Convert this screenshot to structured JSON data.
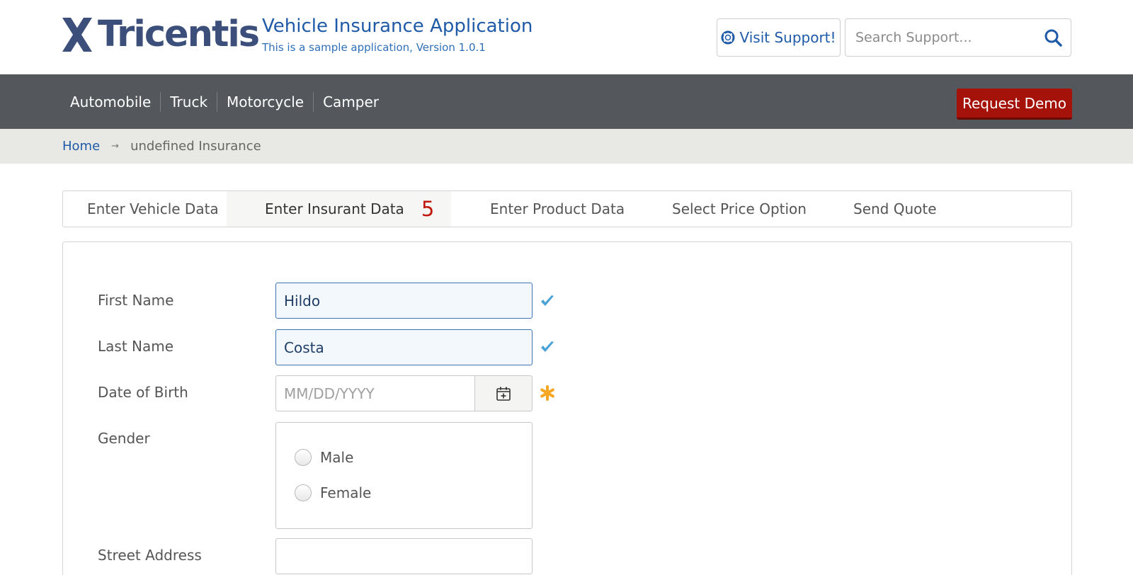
{
  "header": {
    "logo_text": "Tricentis",
    "app_title": "Vehicle Insurance Application",
    "app_subtitle": "This is a sample application, Version 1.0.1",
    "support_label": "Visit Support!",
    "search_placeholder": "Search Support..."
  },
  "nav": {
    "items": [
      {
        "label": "Automobile"
      },
      {
        "label": "Truck"
      },
      {
        "label": "Motorcycle"
      },
      {
        "label": "Camper"
      }
    ],
    "demo_label": "Request Demo"
  },
  "breadcrumb": {
    "home": "Home",
    "separator": "→",
    "current": "undefined Insurance"
  },
  "tabs": [
    {
      "label": "Enter Vehicle Data"
    },
    {
      "label": "Enter Insurant Data",
      "count": "5",
      "active": true
    },
    {
      "label": "Enter Product Data"
    },
    {
      "label": "Select Price Option"
    },
    {
      "label": "Send Quote"
    }
  ],
  "form": {
    "first_name": {
      "label": "First Name",
      "value": "Hildo"
    },
    "last_name": {
      "label": "Last Name",
      "value": "Costa"
    },
    "date_of_birth": {
      "label": "Date of Birth",
      "placeholder": "MM/DD/YYYY"
    },
    "gender": {
      "label": "Gender",
      "options": [
        "Male",
        "Female"
      ]
    },
    "street_address": {
      "label": "Street Address",
      "value": ""
    }
  },
  "icons": {
    "valid": "check-icon",
    "required": "asterisk-icon",
    "calendar": "calendar-icon",
    "support": "lifebuoy-icon",
    "search": "search-icon"
  },
  "colors": {
    "brand_blue": "#1f5aa8",
    "nav_bg": "#54575b",
    "demo_red": "#a4120a",
    "check_blue": "#4aa3d6",
    "required_orange": "#f5a623"
  }
}
